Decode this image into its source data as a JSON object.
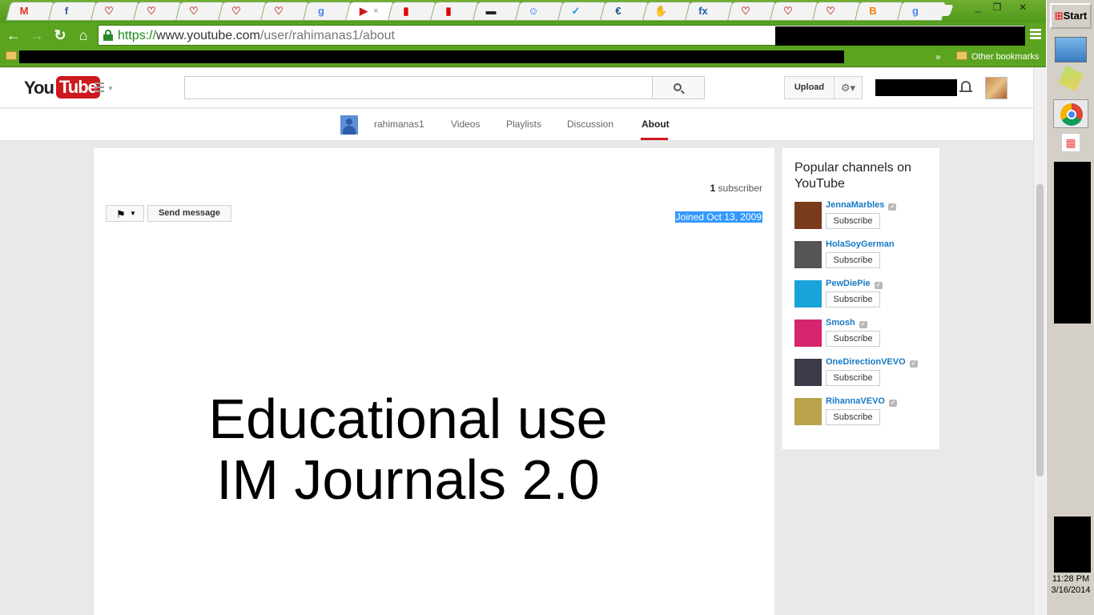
{
  "browser": {
    "tabs": [
      {
        "icon": "gmail-icon",
        "glyph": "M",
        "color": "#d93025"
      },
      {
        "icon": "facebook-icon",
        "glyph": "f",
        "color": "#3b5998"
      },
      {
        "icon": "heart-icon",
        "glyph": "♡",
        "color": "#c0392b"
      },
      {
        "icon": "heart-icon",
        "glyph": "♡",
        "color": "#c0392b"
      },
      {
        "icon": "heart-icon",
        "glyph": "♡",
        "color": "#c0392b"
      },
      {
        "icon": "heart-icon",
        "glyph": "♡",
        "color": "#c0392b"
      },
      {
        "icon": "heart-icon",
        "glyph": "♡",
        "color": "#c0392b"
      },
      {
        "icon": "google-icon",
        "glyph": "g",
        "color": "#4285f4"
      },
      {
        "icon": "youtube-icon",
        "glyph": "▶",
        "color": "#cc181e",
        "active": true
      },
      {
        "icon": "battery-icon",
        "glyph": "▮",
        "color": "#e00000"
      },
      {
        "icon": "battery-icon",
        "glyph": "▮",
        "color": "#e00000"
      },
      {
        "icon": "fan-icon",
        "glyph": "▬",
        "color": "#222"
      },
      {
        "icon": "smiley-icon",
        "glyph": "☺",
        "color": "#1a73e8"
      },
      {
        "icon": "check-icon",
        "glyph": "✓",
        "color": "#1a9ad6"
      },
      {
        "icon": "e-icon",
        "glyph": "€",
        "color": "#1a4b8c"
      },
      {
        "icon": "mitten-icon",
        "glyph": "✋",
        "color": "#d44"
      },
      {
        "icon": "fixya-icon",
        "glyph": "fx",
        "color": "#1a5fb4"
      },
      {
        "icon": "heart-icon",
        "glyph": "♡",
        "color": "#c0392b"
      },
      {
        "icon": "heart-icon",
        "glyph": "♡",
        "color": "#c0392b"
      },
      {
        "icon": "heart-icon",
        "glyph": "♡",
        "color": "#c0392b"
      },
      {
        "icon": "blogger-icon",
        "glyph": "B",
        "color": "#f57d00"
      },
      {
        "icon": "google-icon",
        "glyph": "g",
        "color": "#4285f4"
      }
    ],
    "url_scheme": "https://",
    "url_host": "www.youtube.com",
    "url_path": "/user/rahimanas1/about",
    "other_bookmarks": "Other bookmarks",
    "chevron": "»"
  },
  "youtube": {
    "logo_you": "You",
    "logo_tube": "Tube",
    "search_placeholder": "",
    "upload_label": "Upload",
    "settings_glyph": "⚙▾"
  },
  "channel": {
    "name": "rahimanas1",
    "tabs": [
      "Videos",
      "Playlists",
      "Discussion",
      "About"
    ],
    "active_tab": "About",
    "subscriber_count": "1",
    "subscriber_label": "subscriber",
    "send_message": "Send message",
    "joined": "Joined Oct 13, 2009",
    "description_line1": "Educational use",
    "description_line2": "IM Journals 2.0"
  },
  "sidebar": {
    "heading": "Popular channels on YouTube",
    "subscribe_label": "Subscribe",
    "channels": [
      {
        "name": "JennaMarbles",
        "verified": true,
        "thumb": "#7a3a1c"
      },
      {
        "name": "HolaSoyGerman",
        "verified": false,
        "thumb": "#555"
      },
      {
        "name": "PewDiePie",
        "verified": true,
        "thumb": "#1aa3d9"
      },
      {
        "name": "Smosh",
        "verified": true,
        "thumb": "#d6246e"
      },
      {
        "name": "OneDirectionVEVO",
        "verified": true,
        "thumb": "#3a3a4a"
      },
      {
        "name": "RihannaVEVO",
        "verified": true,
        "thumb": "#b8a24a"
      }
    ]
  },
  "taskbar": {
    "start_label": "Start",
    "time": "11:28 PM",
    "date": "3/16/2014"
  }
}
